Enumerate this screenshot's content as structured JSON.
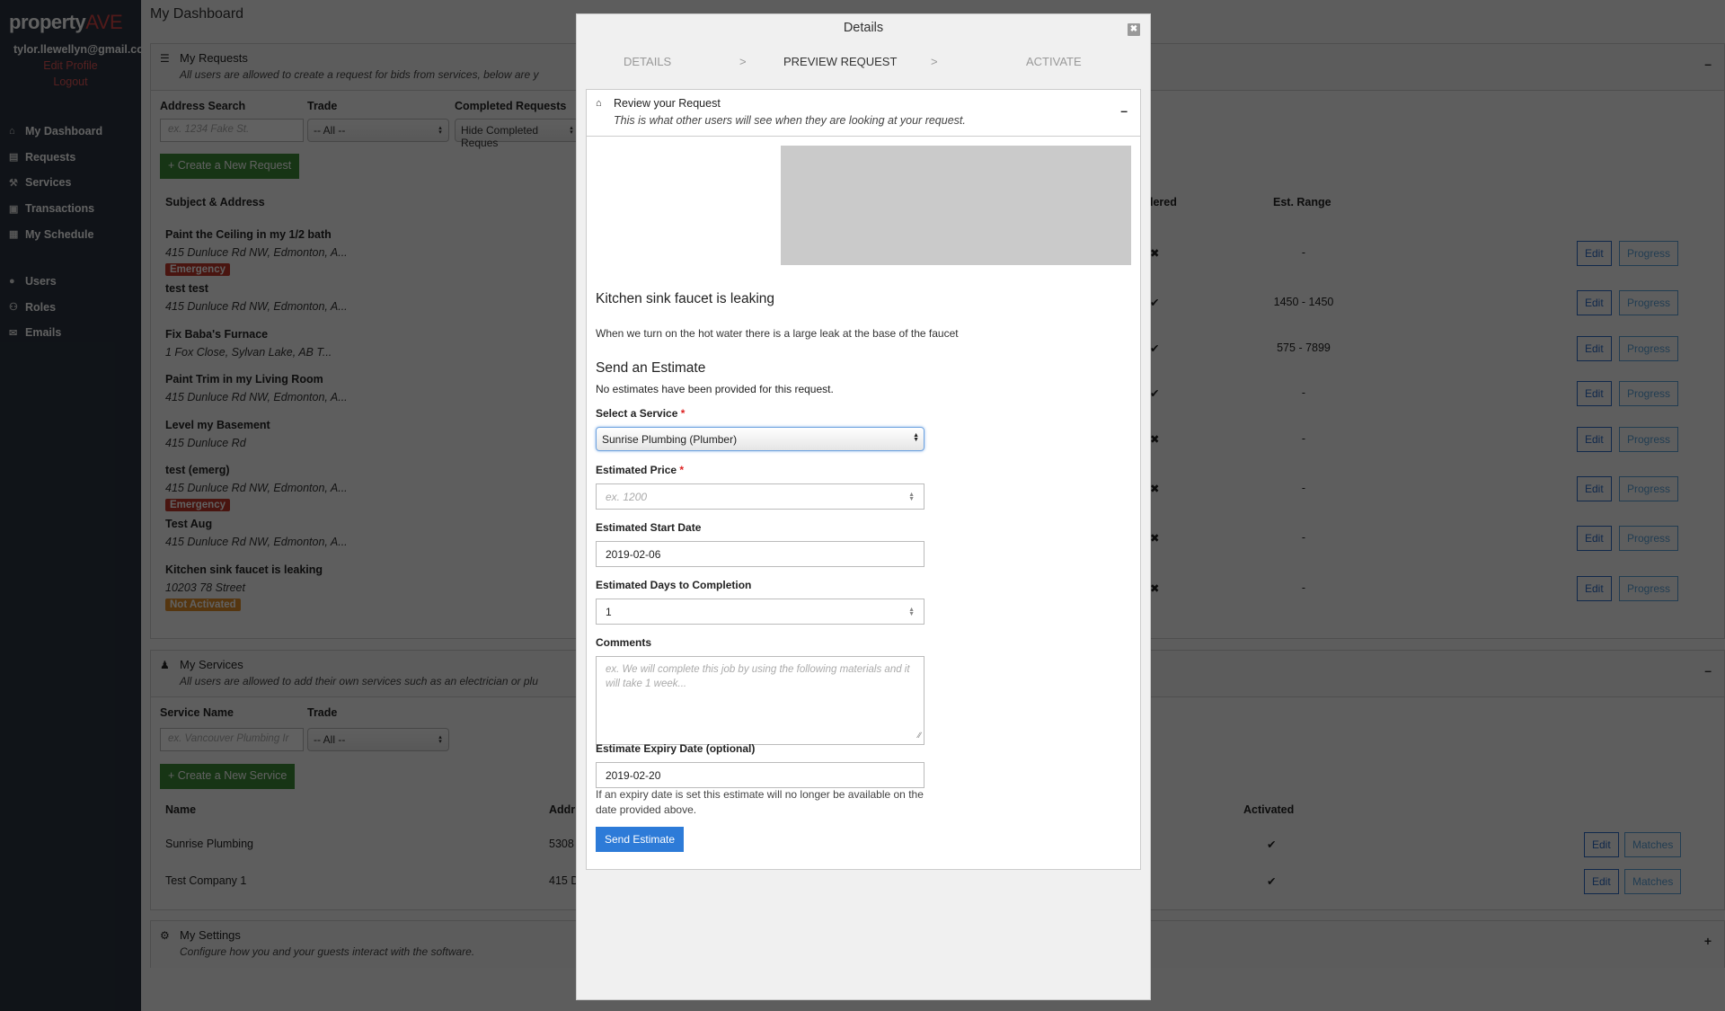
{
  "sidebar": {
    "logo_main": "property",
    "logo_accent": "AVE",
    "user_email": "tylor.llewellyn@gmail.com",
    "edit_profile": "Edit Profile",
    "logout": "Logout",
    "nav_primary": [
      {
        "label": "My Dashboard",
        "icon": "home-icon",
        "glyph": "⌂"
      },
      {
        "label": "Requests",
        "icon": "list-alt-icon",
        "glyph": "▤"
      },
      {
        "label": "Services",
        "icon": "wrench-icon",
        "glyph": "⚒"
      },
      {
        "label": "Transactions",
        "icon": "money-icon",
        "glyph": "▣"
      },
      {
        "label": "My Schedule",
        "icon": "calendar-icon",
        "glyph": "▦"
      }
    ],
    "nav_admin": [
      {
        "label": "Users",
        "icon": "user-icon",
        "glyph": "●"
      },
      {
        "label": "Roles",
        "icon": "users-icon",
        "glyph": "⚇"
      },
      {
        "label": "Emails",
        "icon": "envelope-icon",
        "glyph": "✉"
      }
    ]
  },
  "main": {
    "page_title": "My Dashboard",
    "requests_panel": {
      "title": "My Requests",
      "subtitle": "All users are allowed to create a request for bids from services, below are y",
      "toggle": "–",
      "filters": {
        "address_label": "Address Search",
        "address_placeholder": "ex. 1234 Fake St.",
        "trade_label": "Trade",
        "trade_value": "-- All --",
        "completed_label": "Completed Requests",
        "completed_value": "Hide Completed Reques"
      },
      "create_button": "+ Create a New Request",
      "columns": {
        "subject": "Subject & Address",
        "tendered": "lered",
        "range": "Est. Range"
      },
      "rows": [
        {
          "title": "Paint the Ceiling in my 1/2 bath",
          "address": "415 Dunluce Rd NW, Edmonton, A...",
          "badge": "Emergency",
          "badge_type": "red",
          "tendered": "✖",
          "range": "-",
          "edit": "Edit",
          "progress": "Progress"
        },
        {
          "title": "test test",
          "address": "415 Dunluce Rd NW, Edmonton, A...",
          "badge": "",
          "badge_type": "",
          "tendered": "✔",
          "range": "1450 - 1450",
          "edit": "Edit",
          "progress": "Progress"
        },
        {
          "title": "Fix Baba's Furnace",
          "address": "1 Fox Close, Sylvan Lake, AB T...",
          "badge": "",
          "badge_type": "",
          "tendered": "✔",
          "range": "575 - 7899",
          "edit": "Edit",
          "progress": "Progress"
        },
        {
          "title": "Paint Trim in my Living Room",
          "address": "415 Dunluce Rd NW, Edmonton, A...",
          "badge": "",
          "badge_type": "",
          "tendered": "✔",
          "range": "-",
          "edit": "Edit",
          "progress": "Progress"
        },
        {
          "title": "Level my Basement",
          "address": "415 Dunluce Rd",
          "badge": "",
          "badge_type": "",
          "tendered": "✖",
          "range": "-",
          "edit": "Edit",
          "progress": "Progress"
        },
        {
          "title": "test (emerg)",
          "address": "415 Dunluce Rd NW, Edmonton, A...",
          "badge": "Emergency",
          "badge_type": "red",
          "tendered": "✖",
          "range": "-",
          "edit": "Edit",
          "progress": "Progress"
        },
        {
          "title": "Test Aug",
          "address": "415 Dunluce Rd NW, Edmonton, A...",
          "badge": "",
          "badge_type": "",
          "tendered": "✖",
          "range": "-",
          "edit": "Edit",
          "progress": "Progress"
        },
        {
          "title": "Kitchen sink faucet is leaking",
          "address": "10203 78 Street",
          "badge": "Not Activated",
          "badge_type": "orange",
          "tendered": "✖",
          "range": "-",
          "edit": "Edit",
          "progress": "Progress"
        }
      ]
    },
    "services_panel": {
      "title": "My Services",
      "subtitle": "All users are allowed to add their own services such as an electrician or plu",
      "toggle": "–",
      "filters": {
        "name_label": "Service Name",
        "name_placeholder": "ex. Vancouver Plumbing Ir",
        "trade_label": "Trade",
        "trade_value": "-- All --"
      },
      "create_button": "+ Create a New Service",
      "columns": {
        "name": "Name",
        "address": "Addr",
        "activated": "Activated"
      },
      "rows": [
        {
          "name": "Sunrise Plumbing",
          "address": "5308",
          "activated": "✔",
          "edit": "Edit",
          "matches": "Matches"
        },
        {
          "name": "Test Company 1",
          "address": "415 D",
          "activated": "✔",
          "edit": "Edit",
          "matches": "Matches"
        }
      ]
    },
    "settings_panel": {
      "title": "My Settings",
      "subtitle": "Configure how you and your guests interact with the software.",
      "toggle": "+"
    }
  },
  "modal": {
    "title": "Details",
    "close": "✖",
    "steps": [
      {
        "label": "DETAILS",
        "active": false
      },
      {
        "label": "PREVIEW REQUEST",
        "active": true
      },
      {
        "label": "ACTIVATE",
        "active": false
      }
    ],
    "step_separator": ">",
    "review": {
      "title": "Review your Request",
      "subtitle": "This is what other users will see when they are looking at your request.",
      "toggle": "–"
    },
    "request_title": "Kitchen sink faucet is leaking",
    "request_description": "When we turn on the hot water there is a large leak at the base of the faucet",
    "estimate_heading": "Send an Estimate",
    "estimate_none": "No estimates have been provided for this request.",
    "form": {
      "service_label": "Select a Service",
      "service_value": "Sunrise Plumbing (Plumber)",
      "price_label": "Estimated Price",
      "price_placeholder": "ex. 1200",
      "start_label": "Estimated Start Date",
      "start_value": "2019-02-06",
      "days_label": "Estimated Days to Completion",
      "days_value": "1",
      "comments_label": "Comments",
      "comments_placeholder": "ex. We will complete this job by using the following materials and it will take 1 week...",
      "expiry_label": "Estimate Expiry Date (optional)",
      "expiry_value": "2019-02-20",
      "expiry_help": "If an expiry date is set this estimate will no longer be available on the date provided above.",
      "required_mark": "*",
      "submit": "Send Estimate"
    }
  },
  "colors": {
    "sidebar_bg": "#2b3440",
    "brand_accent": "#d64545",
    "primary_blue": "#2d7bd8",
    "success_green": "#3d8b37",
    "danger_badge": "#c0392b",
    "warning_badge": "#e08e2c"
  }
}
